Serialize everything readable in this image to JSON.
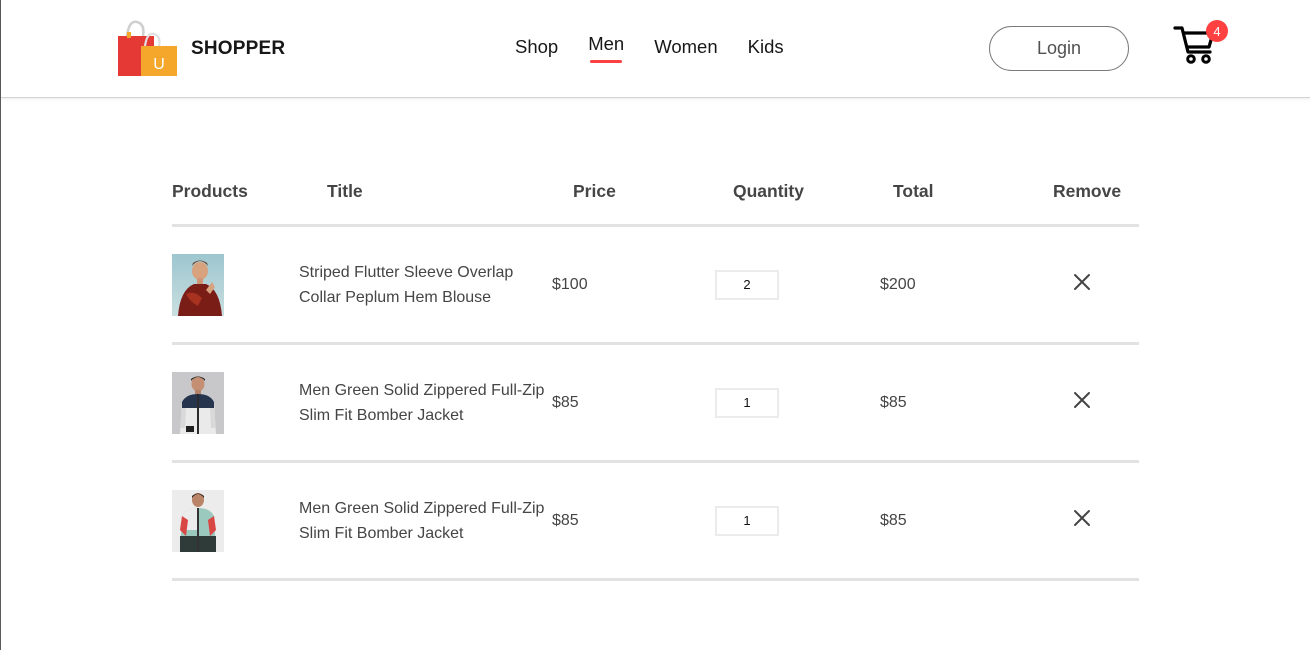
{
  "brand": {
    "name": "SHOPPER",
    "logo_icon": "shopping-bag-icon",
    "bag_letter": "U",
    "colors": {
      "bag_red": "#e53935",
      "bag_orange": "#f4a72a"
    }
  },
  "nav": {
    "items": [
      {
        "label": "Shop",
        "active": false
      },
      {
        "label": "Men",
        "active": true
      },
      {
        "label": "Women",
        "active": false
      },
      {
        "label": "Kids",
        "active": false
      }
    ],
    "active_underline_color": "#ff4141"
  },
  "header": {
    "login_label": "Login",
    "cart_icon": "cart-icon",
    "cart_count": "4",
    "cart_badge_color": "#ff4141"
  },
  "table": {
    "headers": [
      "Products",
      "Title",
      "Price",
      "Quantity",
      "Total",
      "Remove"
    ],
    "rows": [
      {
        "image": "model-in-red-blouse-thumbnail",
        "title": "Striped Flutter Sleeve Overlap Collar Peplum Hem Blouse",
        "price": "$100",
        "quantity": "2",
        "total": "$200",
        "remove_icon": "close-icon"
      },
      {
        "image": "man-in-bomber-jacket-thumbnail",
        "title": "Men Green Solid Zippered Full-Zip Slim Fit Bomber Jacket",
        "price": "$85",
        "quantity": "1",
        "total": "$85",
        "remove_icon": "close-icon"
      },
      {
        "image": "man-in-colorblock-jacket-thumbnail",
        "title": "Men Green Solid Zippered Full-Zip Slim Fit Bomber Jacket",
        "price": "$85",
        "quantity": "1",
        "total": "$85",
        "remove_icon": "close-icon"
      }
    ]
  }
}
